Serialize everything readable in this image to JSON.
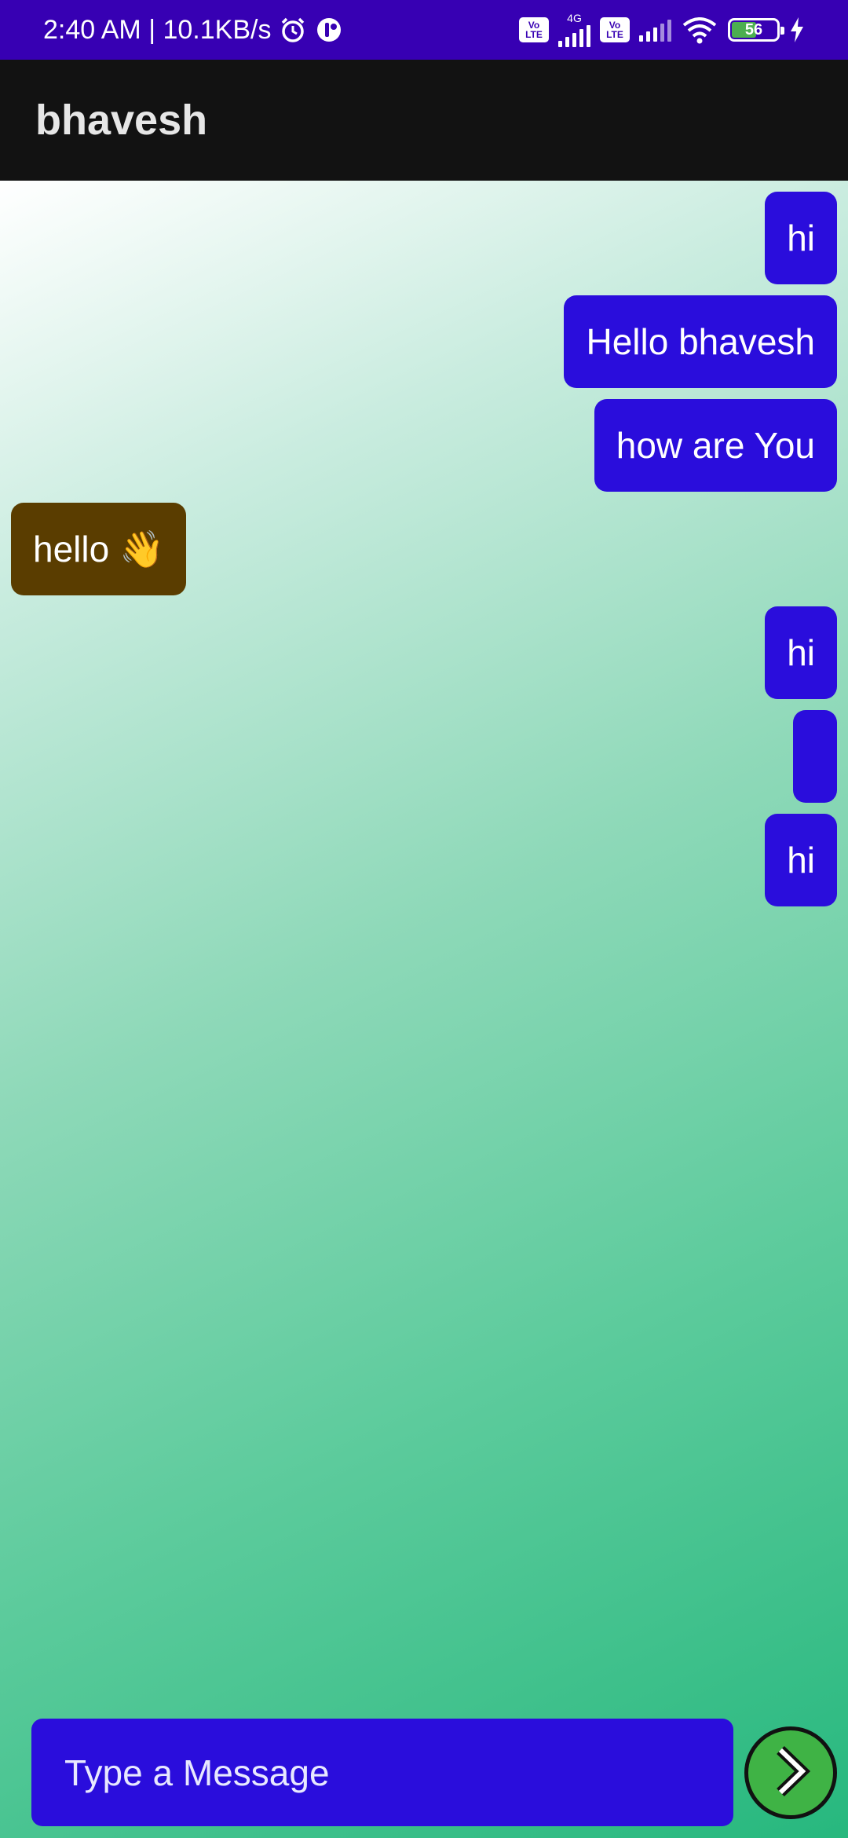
{
  "status_bar": {
    "time": "2:40 AM | 10.1KB/s",
    "volte_label": "Vo LTE",
    "network_label": "4G",
    "battery_level": "56"
  },
  "app_bar": {
    "title": "bhavesh"
  },
  "messages": [
    {
      "direction": "sent",
      "text": "hi"
    },
    {
      "direction": "sent",
      "text": "Hello bhavesh"
    },
    {
      "direction": "sent",
      "text": "how are You"
    },
    {
      "direction": "received",
      "text": "hello 👋"
    },
    {
      "direction": "sent",
      "text": "hi"
    },
    {
      "direction": "sent",
      "text": ""
    },
    {
      "direction": "sent",
      "text": "hi"
    }
  ],
  "composer": {
    "placeholder": "Type a Message",
    "value": ""
  },
  "colors": {
    "status_bar": "#3700b3",
    "app_bar": "#121212",
    "sent_bubble": "#2a0ddc",
    "received_bubble": "#5a3d00",
    "send_button": "#3fb345"
  },
  "icons": {
    "send": "chevron-right-icon",
    "alarm": "alarm-icon",
    "wifi": "wifi-icon",
    "charging": "charging-bolt-icon"
  }
}
